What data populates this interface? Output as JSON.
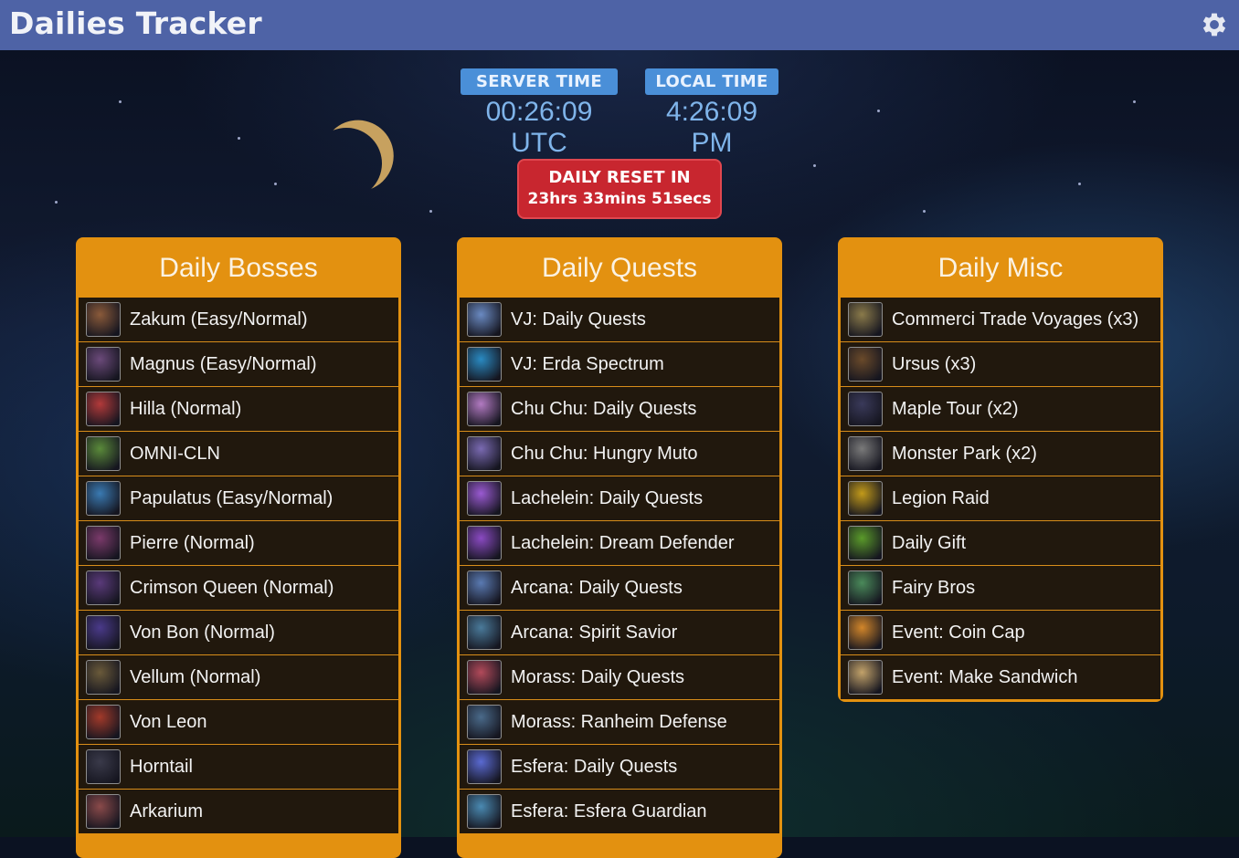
{
  "app": {
    "title": "Dailies Tracker"
  },
  "times": {
    "server_label": "SERVER TIME",
    "server_value": "00:26:09 UTC",
    "local_label": "LOCAL TIME",
    "local_value": "4:26:09 PM"
  },
  "reset": {
    "label": "DAILY RESET IN",
    "countdown": "23hrs 33mins 51secs"
  },
  "panels": {
    "bosses": {
      "title": "Daily Bosses",
      "items": [
        {
          "label": "Zakum (Easy/Normal)",
          "icon": "zakum-icon",
          "color": "#8a5a3a"
        },
        {
          "label": "Magnus (Easy/Normal)",
          "icon": "magnus-icon",
          "color": "#6b4a7a"
        },
        {
          "label": "Hilla (Normal)",
          "icon": "hilla-icon",
          "color": "#b23a3a"
        },
        {
          "label": "OMNI-CLN",
          "icon": "omni-cln-icon",
          "color": "#5a8a3a"
        },
        {
          "label": "Papulatus (Easy/Normal)",
          "icon": "papulatus-icon",
          "color": "#3a7ab2"
        },
        {
          "label": "Pierre (Normal)",
          "icon": "pierre-icon",
          "color": "#7a3a6a"
        },
        {
          "label": "Crimson Queen (Normal)",
          "icon": "crimson-queen-icon",
          "color": "#5a3a7a"
        },
        {
          "label": "Von Bon (Normal)",
          "icon": "von-bon-icon",
          "color": "#4a3a8a"
        },
        {
          "label": "Vellum (Normal)",
          "icon": "vellum-icon",
          "color": "#6a5a3a"
        },
        {
          "label": "Von Leon",
          "icon": "von-leon-icon",
          "color": "#a23a2a"
        },
        {
          "label": "Horntail",
          "icon": "horntail-icon",
          "color": "#3a3a4a"
        },
        {
          "label": "Arkarium",
          "icon": "arkarium-icon",
          "color": "#8a4a4a"
        }
      ]
    },
    "quests": {
      "title": "Daily Quests",
      "items": [
        {
          "label": "VJ: Daily Quests",
          "icon": "vanishing-journey-icon",
          "color": "#6a8ac2"
        },
        {
          "label": "VJ: Erda Spectrum",
          "icon": "erda-drop-icon",
          "color": "#2a8ac2"
        },
        {
          "label": "Chu Chu: Daily Quests",
          "icon": "chu-chu-icon",
          "color": "#b27ac2"
        },
        {
          "label": "Chu Chu: Hungry Muto",
          "icon": "hungry-muto-icon",
          "color": "#7a6ab2"
        },
        {
          "label": "Lachelein: Daily Quests",
          "icon": "lachelein-icon",
          "color": "#9a5ad2"
        },
        {
          "label": "Lachelein: Dream Defender",
          "icon": "butterfly-icon",
          "color": "#8a4ac2"
        },
        {
          "label": "Arcana: Daily Quests",
          "icon": "arcana-icon",
          "color": "#5a7ab2"
        },
        {
          "label": "Arcana: Spirit Savior",
          "icon": "spirit-savior-icon",
          "color": "#4a7a9a"
        },
        {
          "label": "Morass: Daily Quests",
          "icon": "morass-icon",
          "color": "#b24a5a"
        },
        {
          "label": "Morass: Ranheim Defense",
          "icon": "ranheim-defense-icon",
          "color": "#4a6a8a"
        },
        {
          "label": "Esfera: Daily Quests",
          "icon": "esfera-icon",
          "color": "#5a6ad2"
        },
        {
          "label": "Esfera: Esfera Guardian",
          "icon": "esfera-guardian-icon",
          "color": "#4a8ab2"
        }
      ]
    },
    "misc": {
      "title": "Daily Misc",
      "items": [
        {
          "label": "Commerci Trade Voyages (x3)",
          "icon": "commerci-icon",
          "color": "#8a7a4a"
        },
        {
          "label": "Ursus (x3)",
          "icon": "ursus-icon",
          "color": "#6a4a2a"
        },
        {
          "label": "Maple Tour (x2)",
          "icon": "maple-tour-icon",
          "color": "#3a3a5a"
        },
        {
          "label": "Monster Park (x2)",
          "icon": "monster-park-icon",
          "color": "#7a7a7a"
        },
        {
          "label": "Legion Raid",
          "icon": "legion-coin-icon",
          "color": "#c29a1a"
        },
        {
          "label": "Daily Gift",
          "icon": "gift-icon",
          "color": "#5a9a2a"
        },
        {
          "label": "Fairy Bros",
          "icon": "fairy-bros-icon",
          "color": "#4a8a5a"
        },
        {
          "label": "Event: Coin Cap",
          "icon": "mushroom-cap-icon",
          "color": "#d2862a"
        },
        {
          "label": "Event: Make Sandwich",
          "icon": "sandwich-icon",
          "color": "#c2a26a"
        }
      ]
    }
  }
}
